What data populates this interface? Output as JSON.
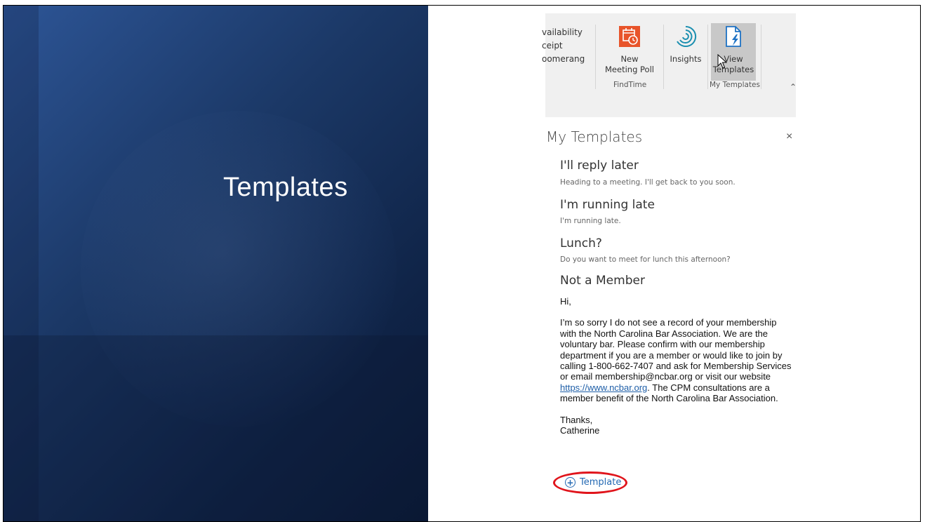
{
  "slide": {
    "title": "Templates"
  },
  "ribbon": {
    "partial_items": [
      "vailability",
      "ceipt",
      "oomerang"
    ],
    "buttons": {
      "new_meeting_poll": {
        "line1": "New",
        "line2": "Meeting Poll"
      },
      "insights": {
        "label": "Insights"
      },
      "view_templates": {
        "line1": "View",
        "line2": "Templates"
      }
    },
    "groups": {
      "findtime": "FindTime",
      "my_templates": "My Templates"
    },
    "colors": {
      "poll_icon": "#e8542a",
      "insights_icon": "#1b8fb0",
      "templates_icon": "#1e72c4"
    }
  },
  "pane": {
    "title": "My Templates",
    "close_icon": "×",
    "templates": [
      {
        "name": "I'll reply later",
        "body": "Heading to a meeting. I'll get back to you soon."
      },
      {
        "name": "I'm running late",
        "body": "I'm running late."
      },
      {
        "name": "Lunch?",
        "body": "Do you want to meet for lunch this afternoon?"
      }
    ],
    "member_template": {
      "name": "Not a Member",
      "greeting": "Hi,",
      "body_before_link": "I’m so sorry I do not see a record of your membership with the North Carolina Bar Association. We are the voluntary bar.  Please confirm with our membership department if you are a member or would like to join by calling 1-800-662-7407 and ask for Membership Services or email membership@ncbar.org or visit our website ",
      "link": "https://www.ncbar.org",
      "body_after_link": ".  The CPM consultations are a member benefit of the North Carolina Bar Association.",
      "signoff": "Thanks,",
      "signature": "Catherine"
    },
    "add_template": {
      "label": "Template",
      "icon": "plus-circle-icon"
    }
  },
  "highlight_color": "#e0141b"
}
